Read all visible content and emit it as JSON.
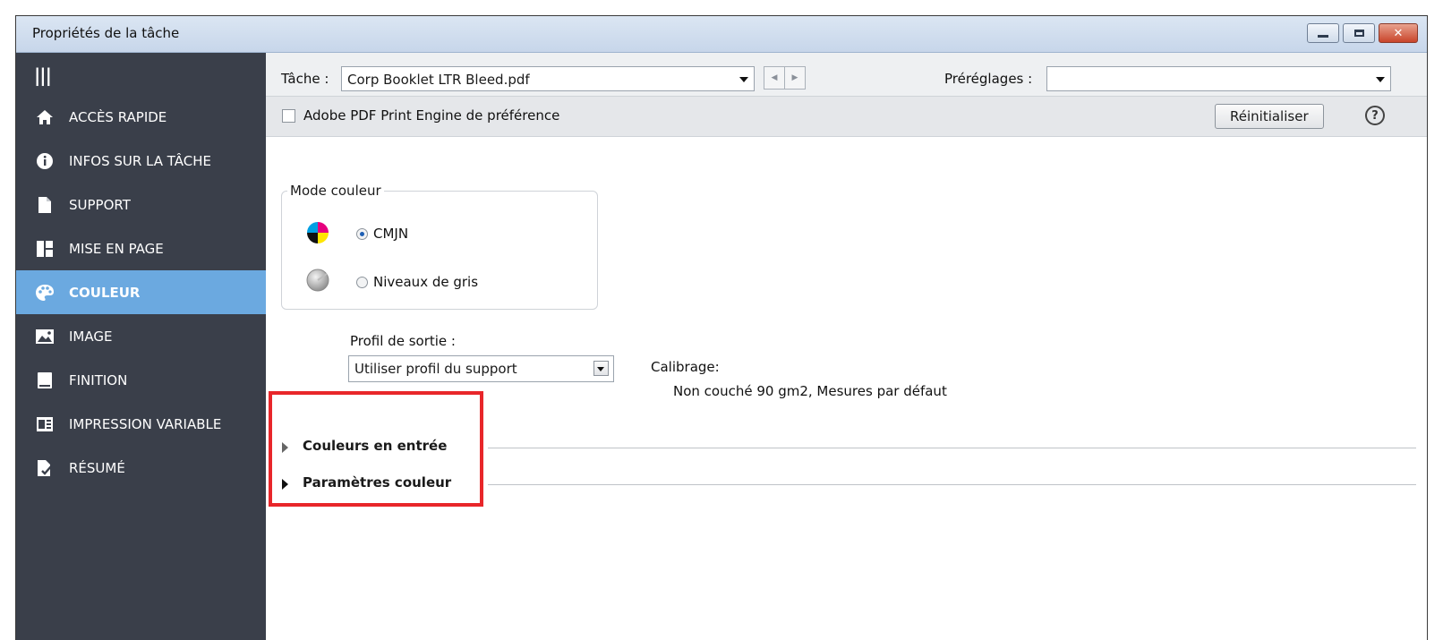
{
  "window": {
    "title": "Propriétés de la tâche"
  },
  "sidebar": {
    "menu_glyph": "|||",
    "items": [
      {
        "label": "ACCÈS RAPIDE",
        "icon": "home-icon"
      },
      {
        "label": "INFOS SUR LA TÂCHE",
        "icon": "info-icon"
      },
      {
        "label": "SUPPORT",
        "icon": "document-icon"
      },
      {
        "label": "MISE EN PAGE",
        "icon": "layout-icon"
      },
      {
        "label": "COULEUR",
        "icon": "palette-icon",
        "active": true
      },
      {
        "label": "IMAGE",
        "icon": "image-icon"
      },
      {
        "label": "FINITION",
        "icon": "book-icon"
      },
      {
        "label": "IMPRESSION VARIABLE",
        "icon": "variable-print-icon"
      },
      {
        "label": "RÉSUMÉ",
        "icon": "summary-icon"
      }
    ]
  },
  "toolbar": {
    "task_label": "Tâche :",
    "task_value": "Corp Booklet LTR Bleed.pdf",
    "presets_label": "Préréglages :",
    "presets_value": ""
  },
  "engine": {
    "checkbox_label": "Adobe PDF Print Engine de préférence",
    "checked": false,
    "reset_label": "Réinitialiser",
    "help_glyph": "?"
  },
  "color_mode": {
    "legend": "Mode couleur",
    "options": [
      {
        "label": "CMJN",
        "selected": true
      },
      {
        "label": "Niveaux de gris",
        "selected": false
      }
    ]
  },
  "output_profile": {
    "label": "Profil de sortie :",
    "value": "Utiliser profil du support"
  },
  "calibration": {
    "label": "Calibrage:",
    "value": "Non couché 90 gm2, Mesures par défaut"
  },
  "sections": [
    {
      "label": "Couleurs en entrée",
      "expanded": false
    },
    {
      "label": "Paramètres couleur",
      "expanded": false
    }
  ],
  "colors": {
    "sidebar_bg": "#3a3f4a",
    "active_item": "#6ba9e0",
    "highlight_box": "#e8262a"
  }
}
